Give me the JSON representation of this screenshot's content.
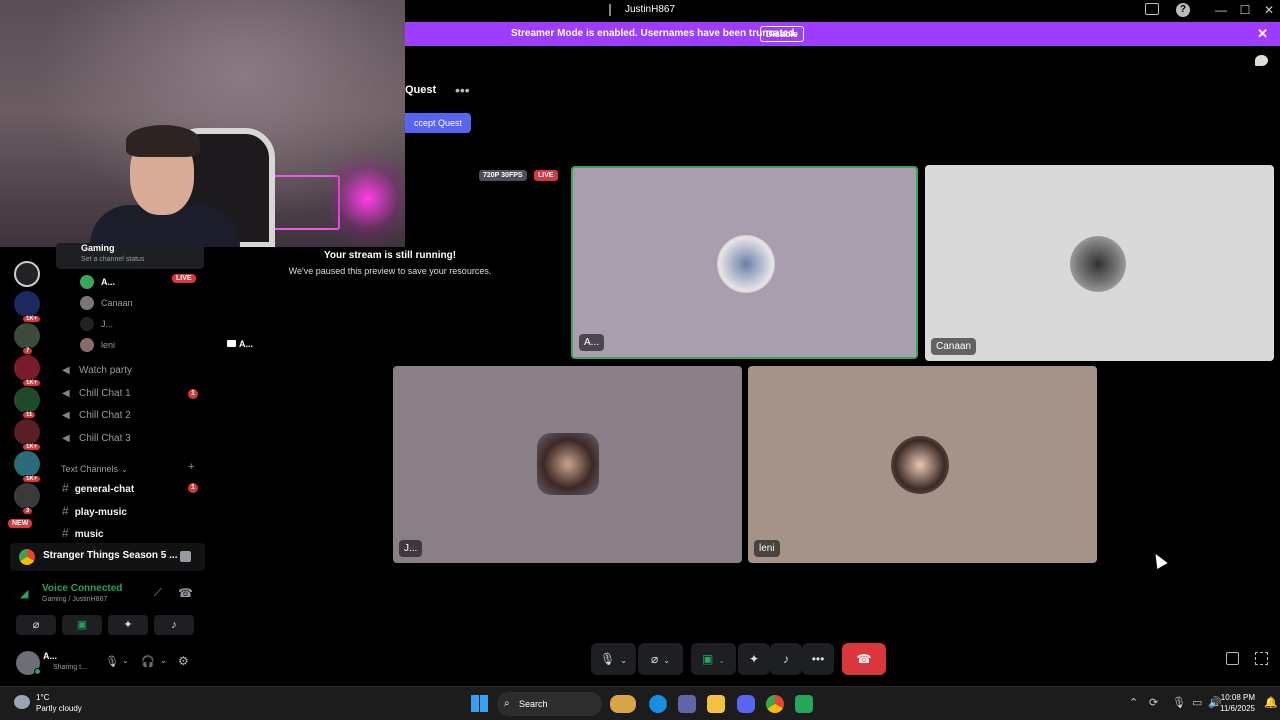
{
  "window": {
    "title": "JustinH867",
    "controls": [
      "—",
      "☐",
      "✕"
    ]
  },
  "banner": {
    "message": "Streamer Mode is enabled. Usernames have been truncated.",
    "disable_label": "Disable",
    "color": "#9c3dff"
  },
  "quest": {
    "title": "Quest",
    "more": "•••",
    "accept_label": "ccept Quest"
  },
  "stream": {
    "quality_badge": "720P 30FPS",
    "live_badge": "LIVE",
    "paused_title": "Your stream is still running!",
    "paused_subtitle": "We've paused this preview to save your resources.",
    "streamer": "A..."
  },
  "tiles": [
    {
      "name": "A...",
      "speaking": true
    },
    {
      "name": "Canaan",
      "speaking": false
    },
    {
      "name": "J...",
      "speaking": false
    },
    {
      "name": "leni",
      "speaking": false
    }
  ],
  "servers": [
    {
      "badge": ""
    },
    {
      "badge": "1K+"
    },
    {
      "badge": "7"
    },
    {
      "badge": "1K+"
    },
    {
      "badge": "11"
    },
    {
      "badge": "1K+"
    },
    {
      "badge": "1K+"
    },
    {
      "badge": "3"
    },
    {
      "badge": "NEW"
    }
  ],
  "channels": {
    "gaming": {
      "name": "Gaming",
      "status": "Set a channel status"
    },
    "members": [
      {
        "name": "A...",
        "live": "LIVE"
      },
      {
        "name": "Canaan"
      },
      {
        "name": "J..."
      },
      {
        "name": "leni"
      }
    ],
    "voice": [
      {
        "name": "Watch party",
        "mentions": ""
      },
      {
        "name": "Chill Chat 1",
        "mentions": "1"
      },
      {
        "name": "Chill Chat 2",
        "mentions": ""
      },
      {
        "name": "Chill Chat 3",
        "mentions": ""
      }
    ],
    "text_header": "Text Channels",
    "text": [
      {
        "name": "general-chat",
        "mentions": "1"
      },
      {
        "name": "play-music",
        "mentions": ""
      },
      {
        "name": "music",
        "mentions": ""
      }
    ]
  },
  "activity": {
    "title": "Stranger Things Season 5 ..."
  },
  "voice_panel": {
    "status": "Voice Connected",
    "location": "Gaming / JustinH867"
  },
  "user_panel": {
    "name": "A...",
    "status": "Sharing t..."
  },
  "taskbar": {
    "temperature": "1°C",
    "weather": "Partly cloudy",
    "search": "Search",
    "time": "10:08 PM",
    "date": "11/6/2025"
  }
}
